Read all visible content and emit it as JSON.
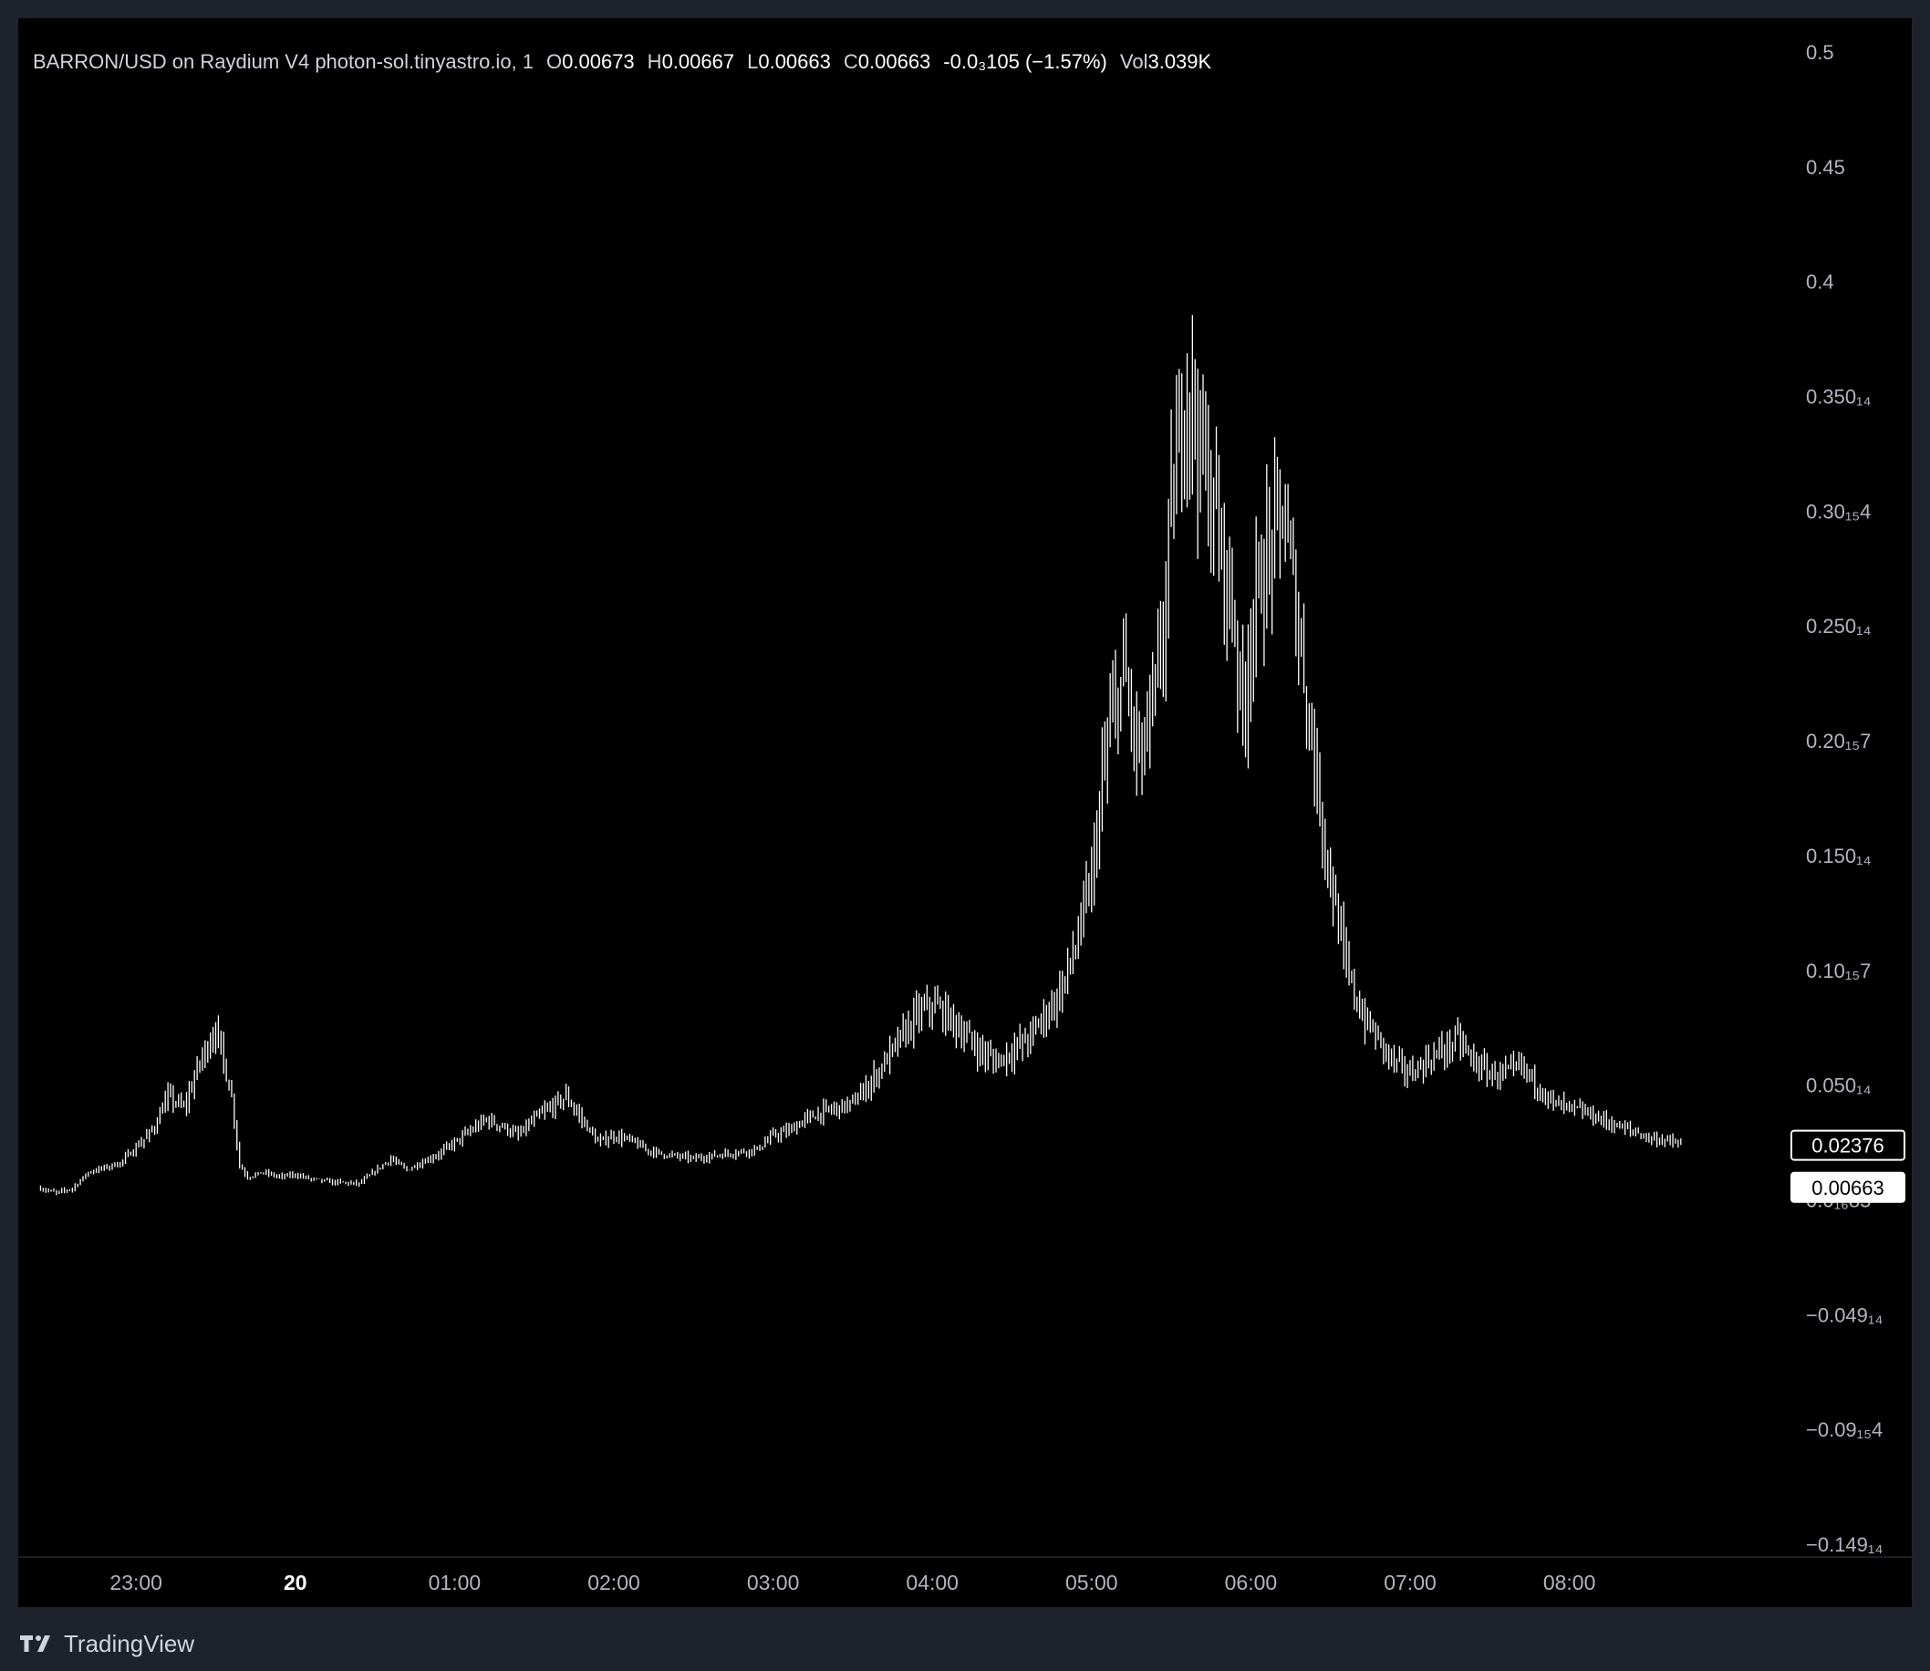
{
  "header": {
    "symbol": "BARRON/USD on Raydium V4 photon-sol.tinyastro.io, 1",
    "o_label": "O",
    "o_value": "0.00673",
    "h_label": "H",
    "h_value": "0.00667",
    "l_label": "L",
    "l_value": "0.00663",
    "c_label": "C",
    "c_value": "0.00663",
    "change": "-0.0₃105 (−1.57%)",
    "vol_label": "Vol",
    "vol_value": "3.039K"
  },
  "footer": {
    "brand": "TradingView",
    "logo_icon": "tradingview-logo-icon"
  },
  "colors": {
    "background": "#000000",
    "outer": "#1e222d",
    "candle": "#ffffff",
    "axis_text": "#b2b5be",
    "separator": "#363a45"
  },
  "chart_data": {
    "type": "line",
    "y_tick_labels": [
      "0.5",
      "0.45",
      "0.4",
      "0.350₁₄",
      "0.30₁₅4",
      "0.250₁₄",
      "0.20₁₅7",
      "0.150₁₄",
      "0.10₁₅7",
      "0.050₁₄",
      "0.0₁₆85",
      "−0.049₁₄",
      "−0.09₁₅4",
      "−0.149₁₄"
    ],
    "y_tick_values": [
      0.5,
      0.45,
      0.4,
      0.35,
      0.3,
      0.25,
      0.2,
      0.15,
      0.1,
      0.05,
      0.0,
      -0.05,
      -0.1,
      -0.15
    ],
    "x_tick_labels": [
      "23:00",
      "20",
      "01:00",
      "02:00",
      "03:00",
      "04:00",
      "05:00",
      "06:00",
      "07:00",
      "08:00"
    ],
    "x_tick_hours": [
      23,
      24,
      25,
      26,
      27,
      28,
      29,
      30,
      31,
      32
    ],
    "x_bold_labels": [
      "20"
    ],
    "ylim": [
      -0.15,
      0.5
    ],
    "xlim_hours": [
      22.26,
      33.4
    ],
    "price_labels": [
      {
        "text": "0.02376",
        "value": 0.0238,
        "style": "outline"
      },
      {
        "text": "0.00663",
        "value": 0.0066,
        "style": "filled"
      }
    ],
    "series": [
      {
        "x": [
          22.4,
          22.5,
          22.6,
          22.7,
          22.8,
          22.9,
          23.0,
          23.1,
          23.2,
          23.3,
          23.4,
          23.5,
          23.6,
          23.65,
          23.7,
          23.8,
          23.9,
          24.0,
          24.1,
          24.2,
          24.4,
          24.6,
          24.7,
          24.9,
          25.0,
          25.2,
          25.3,
          25.4,
          25.5,
          25.6,
          25.7,
          25.8,
          25.9,
          26.0,
          26.1,
          26.2,
          26.3,
          26.5,
          26.7,
          26.9,
          27.0,
          27.1,
          27.2,
          27.3,
          27.4,
          27.5,
          27.6,
          27.7,
          27.8,
          27.9,
          28.0,
          28.1,
          28.2,
          28.3,
          28.4,
          28.5,
          28.6,
          28.7,
          28.8,
          28.9,
          29.0,
          29.05,
          29.1,
          29.2,
          29.3,
          29.4,
          29.45,
          29.5,
          29.55,
          29.6,
          29.7,
          29.8,
          29.9,
          29.95,
          30.0,
          30.1,
          30.2,
          30.3,
          30.35,
          30.4,
          30.5,
          30.6,
          30.7,
          30.8,
          30.9,
          31.0,
          31.1,
          31.2,
          31.3,
          31.4,
          31.5,
          31.6,
          31.7,
          31.8,
          31.9,
          32.0,
          32.1,
          32.2,
          32.3,
          32.4,
          32.5,
          32.6,
          32.7
        ],
        "values": [
          0.005,
          0.003,
          0.005,
          0.012,
          0.014,
          0.016,
          0.023,
          0.03,
          0.045,
          0.04,
          0.06,
          0.075,
          0.045,
          0.015,
          0.01,
          0.012,
          0.01,
          0.011,
          0.009,
          0.008,
          0.007,
          0.018,
          0.013,
          0.02,
          0.025,
          0.035,
          0.032,
          0.028,
          0.035,
          0.04,
          0.045,
          0.035,
          0.025,
          0.028,
          0.026,
          0.022,
          0.02,
          0.018,
          0.02,
          0.022,
          0.028,
          0.03,
          0.035,
          0.038,
          0.04,
          0.042,
          0.05,
          0.06,
          0.07,
          0.08,
          0.085,
          0.08,
          0.072,
          0.065,
          0.06,
          0.065,
          0.07,
          0.08,
          0.09,
          0.11,
          0.14,
          0.17,
          0.2,
          0.23,
          0.19,
          0.22,
          0.25,
          0.3,
          0.33,
          0.36,
          0.32,
          0.29,
          0.25,
          0.21,
          0.25,
          0.28,
          0.3,
          0.25,
          0.22,
          0.19,
          0.14,
          0.1,
          0.08,
          0.07,
          0.06,
          0.055,
          0.06,
          0.065,
          0.07,
          0.06,
          0.055,
          0.055,
          0.058,
          0.05,
          0.042,
          0.04,
          0.038,
          0.035,
          0.032,
          0.03,
          0.027,
          0.026,
          0.024
        ]
      }
    ],
    "grid": false,
    "legend": "none"
  }
}
